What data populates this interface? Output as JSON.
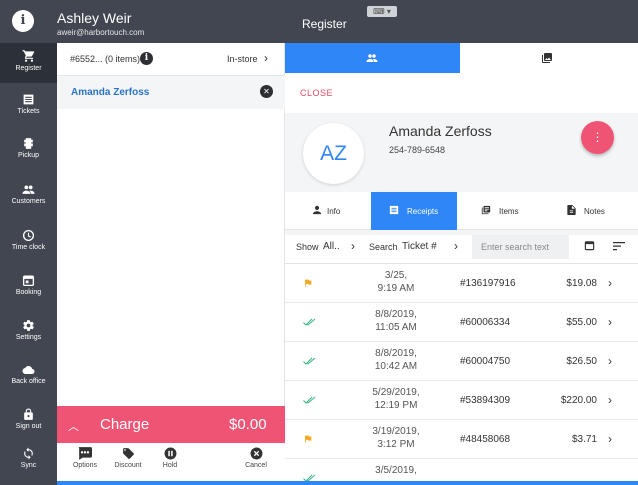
{
  "header": {
    "user_name": "Ashley Weir",
    "user_email": "aweir@harbortouch.com",
    "title": "Register",
    "info_glyph": "i"
  },
  "nav": {
    "items": [
      {
        "label": "Register",
        "icon": "cart-icon",
        "active": true
      },
      {
        "label": "Tickets",
        "icon": "receipt-icon"
      },
      {
        "label": "Pickup",
        "icon": "pickup-icon"
      },
      {
        "label": "Customers",
        "icon": "people-icon"
      },
      {
        "label": "Time clock",
        "icon": "clock-icon"
      },
      {
        "label": "Booking",
        "icon": "calendar-icon"
      },
      {
        "label": "Settings",
        "icon": "gear-icon"
      },
      {
        "label": "Back office",
        "icon": "cloud-icon"
      },
      {
        "label": "Sign out",
        "icon": "lock-icon"
      },
      {
        "label": "Sync",
        "icon": "sync-icon"
      }
    ]
  },
  "cart": {
    "ticket": "#6552... (0 items)",
    "order_type": "In-store",
    "customer_name": "Amanda Zerfoss",
    "charge_label": "Charge",
    "charge_amount": "$0.00",
    "actions": [
      {
        "label": "Options",
        "icon": "more-icon"
      },
      {
        "label": "Discount",
        "icon": "tag-icon"
      },
      {
        "label": "Hold",
        "icon": "pause-icon"
      },
      {
        "label": "Cancel",
        "icon": "cancel-icon"
      }
    ]
  },
  "customer": {
    "close_label": "CLOSE",
    "initials": "AZ",
    "name": "Amanda Zerfoss",
    "phone": "254-789-6548",
    "fab_glyph": "⋮",
    "tabs": [
      {
        "label": "Info",
        "icon": "person-icon"
      },
      {
        "label": "Receipts",
        "icon": "receipt-icon",
        "active": true
      },
      {
        "label": "Items",
        "icon": "items-icon"
      },
      {
        "label": "Notes",
        "icon": "notes-icon"
      }
    ],
    "filter": {
      "show_label": "Show",
      "show_value": "All..",
      "search_label": "Search",
      "search_field": "Ticket #",
      "search_placeholder": "Enter search text"
    },
    "receipts": [
      {
        "status": "flag",
        "date": "3/25,",
        "time": "9:19 AM",
        "number": "#136197916",
        "total": "$19.08"
      },
      {
        "status": "paid",
        "date": "8/8/2019,",
        "time": "11:05 AM",
        "number": "#60006334",
        "total": "$55.00"
      },
      {
        "status": "paid",
        "date": "8/8/2019,",
        "time": "10:42 AM",
        "number": "#60004750",
        "total": "$26.50"
      },
      {
        "status": "paid",
        "date": "5/29/2019,",
        "time": "12:19 PM",
        "number": "#53894309",
        "total": "$220.00"
      },
      {
        "status": "flag",
        "date": "3/19/2019,",
        "time": "3:12 PM",
        "number": "#48458068",
        "total": "$3.71"
      },
      {
        "status": "paid",
        "date": "3/5/2019,",
        "time": "",
        "number": "",
        "total": ""
      }
    ]
  },
  "colors": {
    "nav_bg": "#414650",
    "accent_blue": "#2f86f6",
    "charge_pink": "#ef5474",
    "flag_orange": "#f7a823",
    "check_green": "#35b37e"
  }
}
